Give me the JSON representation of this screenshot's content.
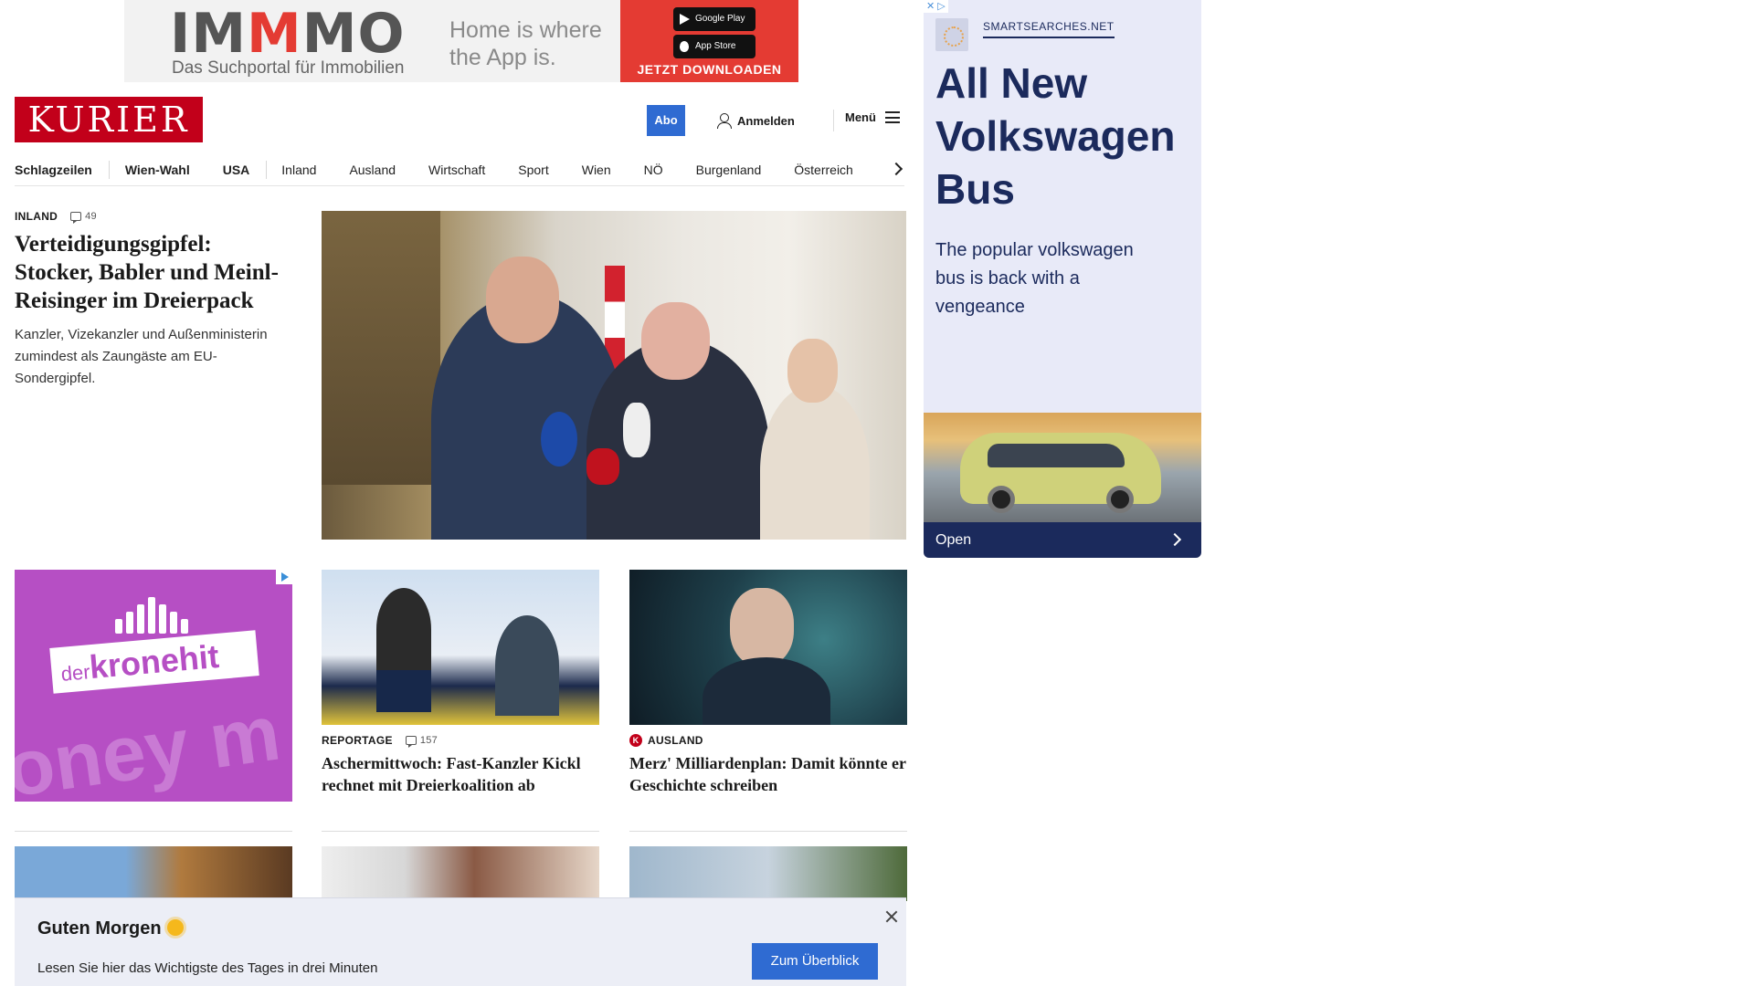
{
  "top_ad": {
    "brand": "IMMMO",
    "tagline": "Das Suchportal für Immobilien",
    "slogan": "Home is where the App is.",
    "google_play": "Google Play",
    "app_store": "App Store",
    "cta": "JETZT DOWNLOADEN"
  },
  "header": {
    "logo": "KURIER",
    "abo": "Abo",
    "login": "Anmelden",
    "menu": "Menü"
  },
  "nav": [
    "Schlagzeilen",
    "Wien-Wahl",
    "USA",
    "Inland",
    "Ausland",
    "Wirtschaft",
    "Sport",
    "Wien",
    "NÖ",
    "Burgenland",
    "Österreich"
  ],
  "lead": {
    "section": "INLAND",
    "comments": "49",
    "title": "Verteidigungsgipfel: Stocker, Babler und Meinl-Reisinger im Dreierpack",
    "teaser": "Kanzler, Vizekanzler und Außenministerin zumindest als Zaungäste am EU-Sondergipfel."
  },
  "cards": [
    {
      "section": "REPORTAGE",
      "comments": "157",
      "title": "Aschermittwoch: Fast-Kanzler Kickl rechnet mit Dreierkoalition ab"
    },
    {
      "section": "AUSLAND",
      "title": "Merz' Milliardenplan: Damit könnte er Geschichte schreiben"
    }
  ],
  "kronehit_ad": {
    "small": "der",
    "big": "kronehit",
    "bg_text": "oney m"
  },
  "side_ad": {
    "sponsor": "SMARTSEARCHES.NET",
    "headline": "All New Volkswagen Bus",
    "body": "The popular volkswagen bus is back with a vengeance",
    "open": "Open"
  },
  "notification": {
    "title": "Guten Morgen",
    "text": "Lesen Sie hier das Wichtigste des Tages in drei Minuten",
    "button": "Zum Überblick"
  },
  "colors": {
    "brand_red": "#c2001a",
    "accent_blue": "#2f6bd2",
    "ad_navy": "#1b2a5c"
  }
}
